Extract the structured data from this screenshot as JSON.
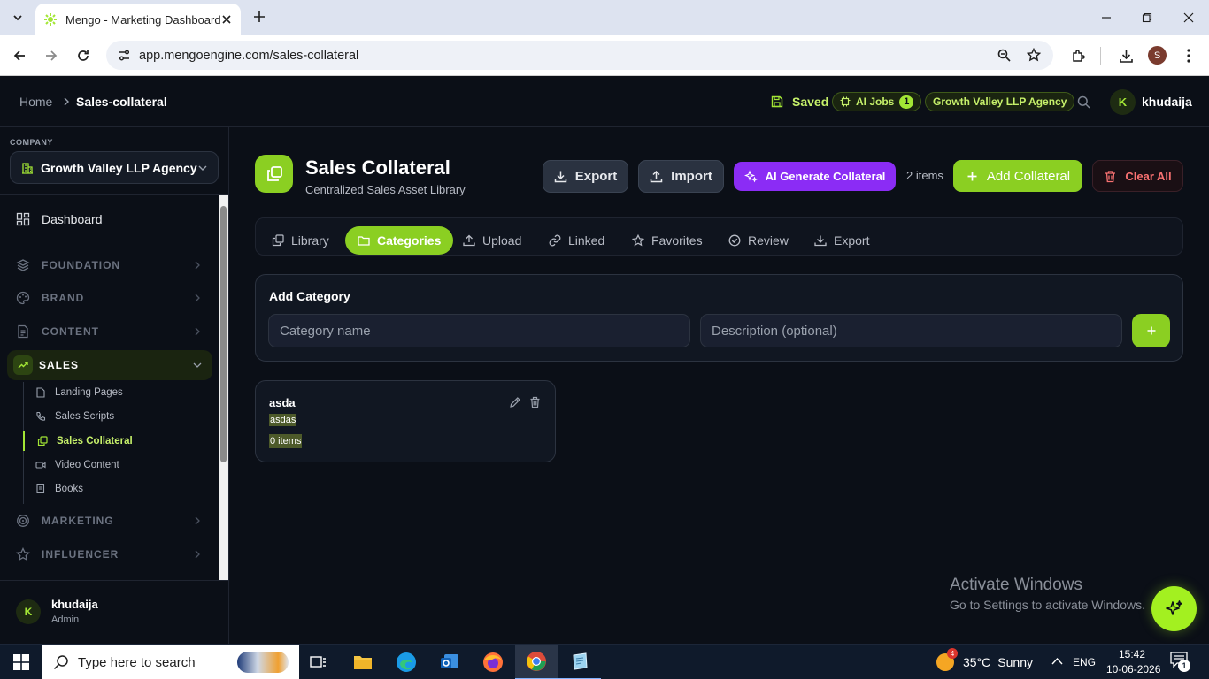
{
  "browser": {
    "tab_title": "Mengo - Marketing Dashboard",
    "url": "app.mengoengine.com/sales-collateral",
    "profile_initial": "S"
  },
  "topnav": {
    "breadcrumb_home": "Home",
    "breadcrumb_current": "Sales-collateral",
    "saved_label": "Saved",
    "ai_jobs_label": "AI Jobs",
    "ai_jobs_count": "1",
    "agency_badge": "Growth Valley LLP Agency",
    "user_initial": "K",
    "user_name": "khudaija"
  },
  "sidebar": {
    "company_label": "COMPANY",
    "company_name": "Growth Valley LLP Agency",
    "dashboard": "Dashboard",
    "sections": [
      {
        "label": "FOUNDATION",
        "icon": "layers-icon"
      },
      {
        "label": "BRAND",
        "icon": "palette-icon"
      },
      {
        "label": "CONTENT",
        "icon": "document-icon"
      },
      {
        "label": "SALES",
        "icon": "trending-up-icon"
      },
      {
        "label": "MARKETING",
        "icon": "target-icon"
      },
      {
        "label": "INFLUENCER",
        "icon": "star-icon"
      }
    ],
    "sales_items": [
      {
        "label": "Landing Pages",
        "icon": "document-icon"
      },
      {
        "label": "Sales Scripts",
        "icon": "phone-icon"
      },
      {
        "label": "Sales Collateral",
        "icon": "copy-icon"
      },
      {
        "label": "Video Content",
        "icon": "video-icon"
      },
      {
        "label": "Books",
        "icon": "book-icon"
      }
    ],
    "footer_initial": "K",
    "footer_name": "khudaija",
    "footer_role": "Admin"
  },
  "header": {
    "title": "Sales Collateral",
    "subtitle": "Centralized Sales Asset Library",
    "export_label": "Export",
    "import_label": "Import",
    "ai_generate_label": "AI Generate Collateral",
    "items_count": "2 items",
    "add_label": "Add Collateral",
    "clear_label": "Clear All"
  },
  "tabs": [
    {
      "label": "Library",
      "icon": "copy-icon"
    },
    {
      "label": "Categories",
      "icon": "folder-icon"
    },
    {
      "label": "Upload",
      "icon": "upload-icon"
    },
    {
      "label": "Linked",
      "icon": "link-icon"
    },
    {
      "label": "Favorites",
      "icon": "star-icon"
    },
    {
      "label": "Review",
      "icon": "check-circle-icon"
    },
    {
      "label": "Export",
      "icon": "download-icon"
    }
  ],
  "active_tab": "Categories",
  "add_category": {
    "title": "Add Category",
    "name_placeholder": "Category name",
    "desc_placeholder": "Description (optional)"
  },
  "categories": [
    {
      "name": "asda",
      "description": "asdas",
      "count": "0 items"
    }
  ],
  "watermark": {
    "line1": "Activate Windows",
    "line2": "Go to Settings to activate Windows."
  },
  "taskbar": {
    "search_placeholder": "Type here to search",
    "weather_temp": "35°C",
    "weather_desc": "Sunny",
    "weather_badge": "4",
    "lang": "ENG",
    "time": "15:42",
    "date": "10-06-2026",
    "notif_count": "1"
  },
  "colors": {
    "accent": "#a3e635",
    "ai_purple": "#8b2cf5",
    "danger": "#f87171",
    "bg": "#0b0f17"
  }
}
